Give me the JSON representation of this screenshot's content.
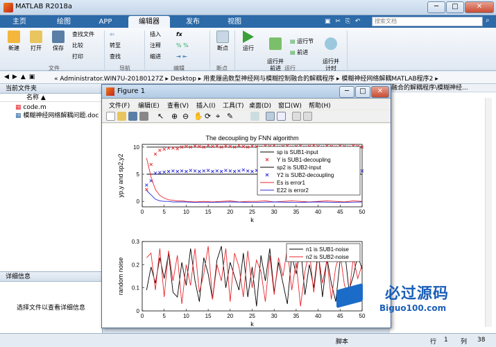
{
  "window": {
    "title": "MATLAB R2018a",
    "minimize": "─",
    "maximize": "□",
    "close": "✕"
  },
  "tabs": [
    "主页",
    "绘图",
    "APP",
    "编辑器",
    "发布",
    "视图"
  ],
  "search_placeholder": "搜索文档",
  "ribbon": {
    "new": "新建",
    "open": "打开",
    "save": "保存",
    "find_files": "查找文件",
    "compare": "比较",
    "print": "打印",
    "insert": "插入",
    "comment": "注释",
    "indent": "缩进",
    "goto": "转至",
    "find": "查找",
    "breakpoints": "断点",
    "run": "运行",
    "run_advance": "运行并\n前进",
    "run_section": "运行节",
    "advance": "前进",
    "run_time": "运行并\n计时",
    "groups": [
      "文件",
      "导航",
      "编辑",
      "断点",
      "运行"
    ]
  },
  "address": {
    "path": "« Administrator.WIN7U-20180127Z  ▸  Desktop  ▸  用麦履函数型神经网与模糊控制融合的解耦程序  ▸  模糊神经网络解耦MATLAB程序2  ▸"
  },
  "left_pane": {
    "title": "当前文件夹",
    "column": "名称 ▲",
    "files": [
      "code.m",
      "模糊神经网络解耦问题.doc"
    ]
  },
  "detail_pane": {
    "title": "详细信息",
    "message": "选择文件以查看详细信息"
  },
  "right_pane": {
    "line1": "融合的解耦程序\\模糊神经..."
  },
  "statusbar": {
    "mode": "脚本",
    "row_label": "行",
    "row": "1",
    "col_label": "列",
    "col": "38"
  },
  "figure": {
    "title": "Figure 1",
    "menu": [
      "文件(F)",
      "编辑(E)",
      "查看(V)",
      "插入(I)",
      "工具(T)",
      "桌面(D)",
      "窗口(W)",
      "帮助(H)"
    ]
  },
  "chart_data": [
    {
      "type": "line",
      "title": "The decoupling by FNN algorithm",
      "xlabel": "k",
      "ylabel": "yp,y and sp2,y2",
      "xlim": [
        0,
        50
      ],
      "ylim": [
        -1,
        10.5
      ],
      "xticks": [
        0,
        5,
        10,
        15,
        20,
        25,
        30,
        35,
        40,
        45,
        50
      ],
      "yticks": [
        0,
        5,
        10
      ],
      "legend_position": "top-right",
      "series": [
        {
          "name": "sp is SUB1-input",
          "color": "#000000",
          "style": "line",
          "x": [
            1,
            50
          ],
          "y": [
            10,
            10
          ]
        },
        {
          "name": "Y is SUB1-decoupling",
          "color": "#e8252c",
          "style": "x",
          "x": [
            1,
            2,
            3,
            4,
            5,
            6,
            7,
            8,
            9,
            10,
            11,
            12,
            13,
            14,
            15,
            16,
            17,
            18,
            19,
            20,
            21,
            22,
            23,
            24,
            25,
            26,
            27,
            28,
            29,
            30,
            31,
            32,
            33,
            34,
            35,
            36,
            37,
            38,
            39,
            40,
            41,
            42,
            43,
            44,
            45,
            46,
            47,
            48,
            49,
            50
          ],
          "y": [
            2.2,
            6.8,
            8.7,
            9.4,
            9.6,
            9.8,
            9.8,
            9.7,
            10,
            10.1,
            10,
            10.2,
            10.1,
            10,
            10.3,
            10.1,
            10.2,
            10,
            10.2,
            10.1,
            10,
            10.3,
            10.1,
            10,
            10.2,
            10.1,
            10,
            10.2,
            10.1,
            10.3,
            10,
            10.1,
            10.2,
            10,
            10.1,
            10.2,
            10,
            10.1,
            10.3,
            10.1,
            10,
            10.2,
            10.1,
            10,
            10.2,
            10.1,
            10,
            10.2,
            10.1,
            10
          ]
        },
        {
          "name": "sp2 is SUB2-input",
          "color": "#000000",
          "style": "line",
          "x": [
            1,
            50
          ],
          "y": [
            5,
            5
          ]
        },
        {
          "name": "Y2 is SUB2-decoupling",
          "color": "#2b2bd6",
          "style": "x",
          "x": [
            1,
            2,
            3,
            4,
            5,
            6,
            7,
            8,
            9,
            10,
            11,
            12,
            13,
            14,
            15,
            16,
            17,
            18,
            19,
            20,
            21,
            22,
            23,
            24,
            25,
            26,
            27,
            28,
            29,
            30,
            31,
            32,
            33,
            34,
            35,
            36,
            37,
            38,
            39,
            40,
            41,
            42,
            43,
            44,
            45,
            46,
            47,
            48,
            49,
            50
          ],
          "y": [
            3,
            3.8,
            5.2,
            5.3,
            5.4,
            5.5,
            5.6,
            5.5,
            5.6,
            5.5,
            5.7,
            5.6,
            5.5,
            5.6,
            5.7,
            5.5,
            5.6,
            5.5,
            5.7,
            5.6,
            5.5,
            5.6,
            5.8,
            5.6,
            5.5,
            5.7,
            5.6,
            5.5,
            5.6,
            5.7,
            5.5,
            5.6,
            5.5,
            5.6,
            5.7,
            5.5,
            5.6,
            5.7,
            5.5,
            5.6,
            5.5,
            5.7,
            5.6,
            5.5,
            5.6,
            5.7,
            5.5,
            5.6,
            5.5,
            5.6
          ]
        },
        {
          "name": "Es is error1",
          "color": "#e8252c",
          "style": "line",
          "x": [
            1,
            2,
            3,
            4,
            5,
            6,
            7,
            8,
            9,
            10,
            12,
            14,
            16,
            18,
            20,
            22,
            24,
            26,
            28,
            30,
            32,
            34,
            36,
            38,
            40,
            42,
            44,
            46,
            48,
            50
          ],
          "y": [
            8,
            4.5,
            2.2,
            1.1,
            0.6,
            0.3,
            0.2,
            0.1,
            0.1,
            0,
            -0.1,
            0,
            -0.1,
            0,
            0.1,
            -0.1,
            0,
            0,
            0.1,
            -0.1,
            0,
            0.1,
            0,
            -0.1,
            0,
            0.1,
            0,
            -0.1,
            0.1,
            0
          ]
        },
        {
          "name": "E22 is error2",
          "color": "#2b2bd6",
          "style": "line",
          "x": [
            1,
            2,
            3,
            4,
            5,
            6,
            7,
            8,
            10,
            12,
            15,
            20,
            25,
            30,
            35,
            40,
            45,
            50
          ],
          "y": [
            2,
            1.2,
            0.4,
            0.1,
            0,
            0,
            -0.1,
            -0.1,
            -0.1,
            -0.2,
            -0.2,
            -0.1,
            -0.2,
            -0.1,
            -0.2,
            -0.1,
            -0.2,
            -0.1
          ]
        }
      ]
    },
    {
      "type": "line",
      "xlabel": "k",
      "ylabel": "random noise",
      "xlim": [
        0,
        50
      ],
      "ylim": [
        0,
        0.3
      ],
      "xticks": [
        0,
        5,
        10,
        15,
        20,
        25,
        30,
        35,
        40,
        45,
        50
      ],
      "yticks": [
        0,
        0.1,
        0.2,
        0.3
      ],
      "legend_position": "top-right",
      "series": [
        {
          "name": "n1 is SUB1-noise",
          "color": "#000000",
          "style": "line",
          "x": [
            1,
            2,
            3,
            4,
            5,
            6,
            7,
            8,
            9,
            10,
            11,
            12,
            13,
            14,
            15,
            16,
            17,
            18,
            19,
            20,
            21,
            22,
            23,
            24,
            25,
            26,
            27,
            28,
            29,
            30,
            31,
            32,
            33,
            34,
            35,
            36,
            37,
            38,
            39,
            40,
            41,
            42,
            43,
            44,
            45,
            46,
            47,
            48,
            49,
            50
          ],
          "y": [
            0.09,
            0.19,
            0.12,
            0.23,
            0.14,
            0.25,
            0.08,
            0.06,
            0.21,
            0.11,
            0.27,
            0.13,
            0.04,
            0.23,
            0.16,
            0.05,
            0.22,
            0.28,
            0.1,
            0.21,
            0.15,
            0.09,
            0.25,
            0.06,
            0.19,
            0.02,
            0.24,
            0.13,
            0.27,
            0.08,
            0.21,
            0.12,
            0.03,
            0.24,
            0.16,
            0.28,
            0.07,
            0.2,
            0.1,
            0.26,
            0.06,
            0.23,
            0.12,
            0.04,
            0.22,
            0.27,
            0.09,
            0.15,
            0.24,
            0.18
          ]
        },
        {
          "name": "n2 is SUB2-noise",
          "color": "#e8252c",
          "style": "line",
          "x": [
            1,
            2,
            3,
            4,
            5,
            6,
            7,
            8,
            9,
            10,
            11,
            12,
            13,
            14,
            15,
            16,
            17,
            18,
            19,
            20,
            21,
            22,
            23,
            24,
            25,
            26,
            27,
            28,
            29,
            30,
            31,
            32,
            33,
            34,
            35,
            36,
            37,
            38,
            39,
            40,
            41,
            42,
            43,
            44,
            45,
            46,
            47,
            48,
            49,
            50
          ],
          "y": [
            0.23,
            0.25,
            0.09,
            0.27,
            0.06,
            0.26,
            0.13,
            0.24,
            0.03,
            0.2,
            0.11,
            0.27,
            0.08,
            0.16,
            0.28,
            0.05,
            0.2,
            0.13,
            0.27,
            0.04,
            0.25,
            0.19,
            0.06,
            0.26,
            0.1,
            0.22,
            0.17,
            0.04,
            0.24,
            0.07,
            0.23,
            0.15,
            0.27,
            0.09,
            0.21,
            0.02,
            0.17,
            0.26,
            0.08,
            0.25,
            0.12,
            0.22,
            0.05,
            0.19,
            0.25,
            0.11,
            0.07,
            0.23,
            0.14,
            0.2
          ]
        }
      ]
    }
  ],
  "watermark": {
    "text": "必过源码",
    "url": "Biguo100.com"
  },
  "colors": {
    "tabbar": "#2c6aa8",
    "accent_red": "#e8252c",
    "accent_blue": "#2b2bd6"
  }
}
